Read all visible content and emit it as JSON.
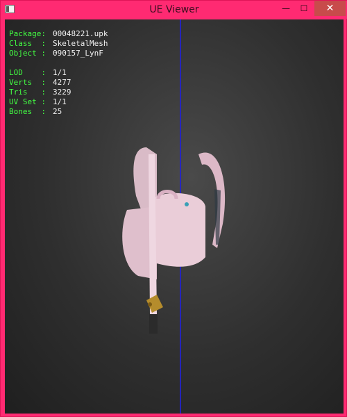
{
  "window": {
    "title": "UE Viewer",
    "controls": {
      "minimize": "—",
      "maximize": "☐",
      "close": "✕"
    }
  },
  "viewport": {
    "info": {
      "package_label": "Package:",
      "package_value": "00048221.upk",
      "class_label": "Class  :",
      "class_value": "SkeletalMesh",
      "object_label": "Object :",
      "object_value": "090157_LynF",
      "lod_label": "LOD    :",
      "lod_value": "1/1",
      "verts_label": "Verts  :",
      "verts_value": "4277",
      "tris_label": "Tris   :",
      "tris_value": "3229",
      "uvset_label": "UV Set :",
      "uvset_value": "1/1",
      "bones_label": "Bones  :",
      "bones_value": "25"
    },
    "model": {
      "name": "backpack-mesh",
      "color": "#e8c7d3",
      "accent": "#b58c2c"
    },
    "axis_color": "#2323c9"
  }
}
